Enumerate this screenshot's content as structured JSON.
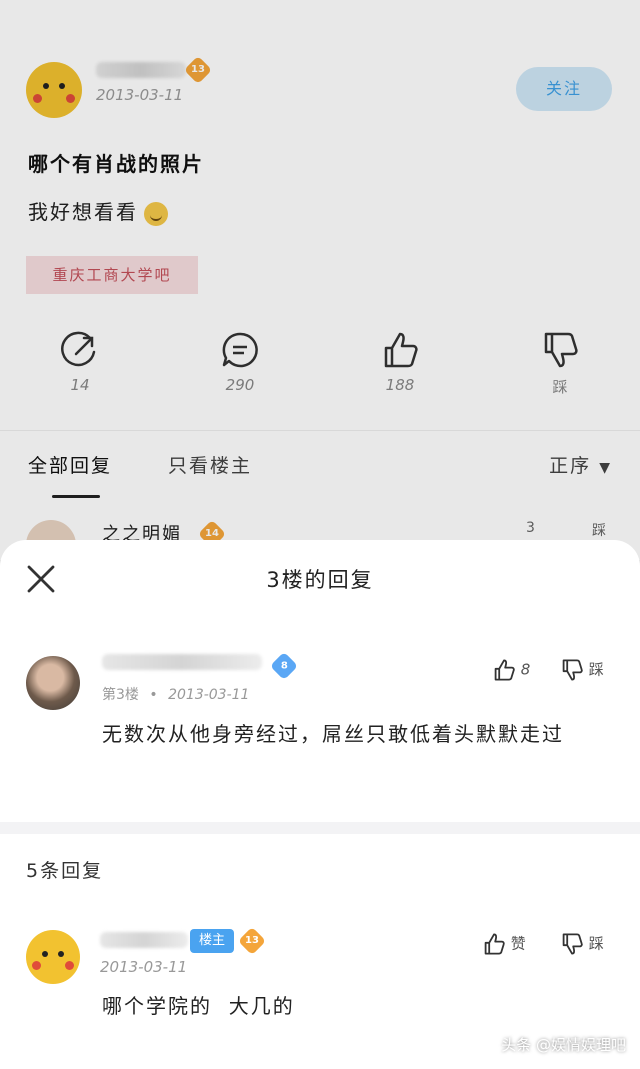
{
  "post": {
    "avatar": "pikachu-avatar",
    "level": "13",
    "date": "2013-03-11",
    "follow_label": "关注",
    "title": "哪个有肖战的照片",
    "body": "我好想看看",
    "emoji": "grin-emoji",
    "forum_tag": "重庆工商大学吧",
    "stats": {
      "share": "14",
      "comments": "290",
      "likes": "188",
      "dislike": "踩"
    },
    "tabs": {
      "all": "全部回复",
      "op_only": "只看楼主"
    },
    "sort_label": "正序",
    "peek_reply": {
      "username": "之之明媚",
      "level": "14",
      "likes": "3",
      "dislike": "踩"
    }
  },
  "sheet": {
    "title": "3楼的回复",
    "main_reply": {
      "level": "8",
      "floor": "第3楼",
      "date": "2013-03-11",
      "likes": "8",
      "dislike": "踩",
      "text": "无数次从他身旁经过，屌丝只敢低着头默默走过"
    },
    "reply_count": "5条回复",
    "sub_reply": {
      "op_badge": "楼主",
      "level": "13",
      "date": "2013-03-11",
      "like_label": "赞",
      "dislike": "踩",
      "text": "哪个学院的  大几的"
    }
  },
  "watermark": "头条 @娱情娱理吧",
  "colors": {
    "accent_blue": "#3ea0e6",
    "tag_red": "#c4505a",
    "level_orange": "#f4a53a"
  }
}
